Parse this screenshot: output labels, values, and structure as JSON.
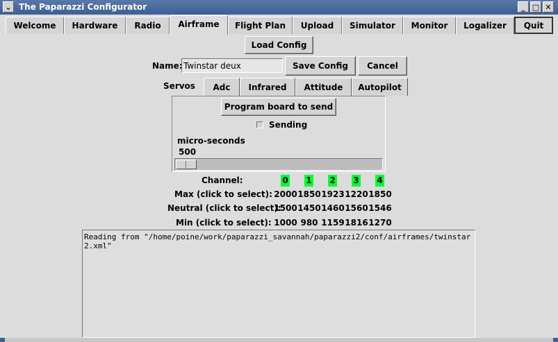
{
  "window": {
    "title": "The Paparazzi Configurator",
    "menu_glyph": "⌄",
    "minimize_glyph": "_",
    "maximize_glyph": "□",
    "close_glyph": "✕"
  },
  "tabs": [
    {
      "label": "Welcome"
    },
    {
      "label": "Hardware"
    },
    {
      "label": "Radio"
    },
    {
      "label": "Airframe",
      "active": true
    },
    {
      "label": "Flight Plan"
    },
    {
      "label": "Upload"
    },
    {
      "label": "Simulator"
    },
    {
      "label": "Monitor"
    },
    {
      "label": "Logalizer"
    },
    {
      "label": "Quit"
    }
  ],
  "airframe": {
    "load_config_label": "Load Config",
    "name_label": "Name:",
    "name_value": "Twinstar deux",
    "save_config_label": "Save Config",
    "cancel_label": "Cancel"
  },
  "subtabs": [
    {
      "label": "Servos",
      "active": true
    },
    {
      "label": "Adc"
    },
    {
      "label": "Infrared"
    },
    {
      "label": "Attitude"
    },
    {
      "label": "Autopilot"
    }
  ],
  "servos": {
    "program_button_label": "Program board to send",
    "sending_label": "Sending",
    "sending_checked": false,
    "unit_label": "micro-seconds",
    "slider_value": "500"
  },
  "channels": {
    "channel_label": "Channel:",
    "ids": [
      "0",
      "1",
      "2",
      "3",
      "4"
    ],
    "highlight_color": "#00ff2b",
    "max_label": "Max (click to select):",
    "max": [
      "2000",
      "1850",
      "1923",
      "1220",
      "1850"
    ],
    "neutral_label": "Neutral (click to select):",
    "neutral": [
      "1500",
      "1450",
      "1460",
      "1560",
      "1546"
    ],
    "min_label": "Min (click to select):",
    "min": [
      "1000",
      "980",
      "1159",
      "1816",
      "1270"
    ]
  },
  "log": {
    "text": "Reading from \"/home/poine/work/paparazzi_savannah/paparazzi2/conf/airframes/twinstar2.xml\""
  },
  "colors": {
    "titlebar": "#3d5f95",
    "background": "#dcdcdc"
  }
}
